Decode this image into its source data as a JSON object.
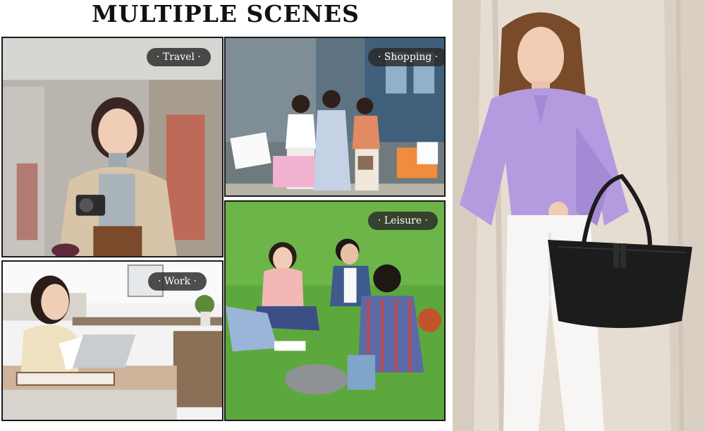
{
  "header": {
    "title": "MULTIPLE SCENES"
  },
  "scenes": [
    {
      "key": "travel",
      "label": "· Travel ·"
    },
    {
      "key": "shopping",
      "label": "· Shopping ·"
    },
    {
      "key": "work",
      "label": "· Work ·"
    },
    {
      "key": "leisure",
      "label": "· Leisure ·"
    }
  ],
  "palette": {
    "label_bg": "#2b2b2b",
    "shirt": "#b49be0",
    "bag": "#1c1c1c",
    "curtain": "#e6ddd2"
  }
}
